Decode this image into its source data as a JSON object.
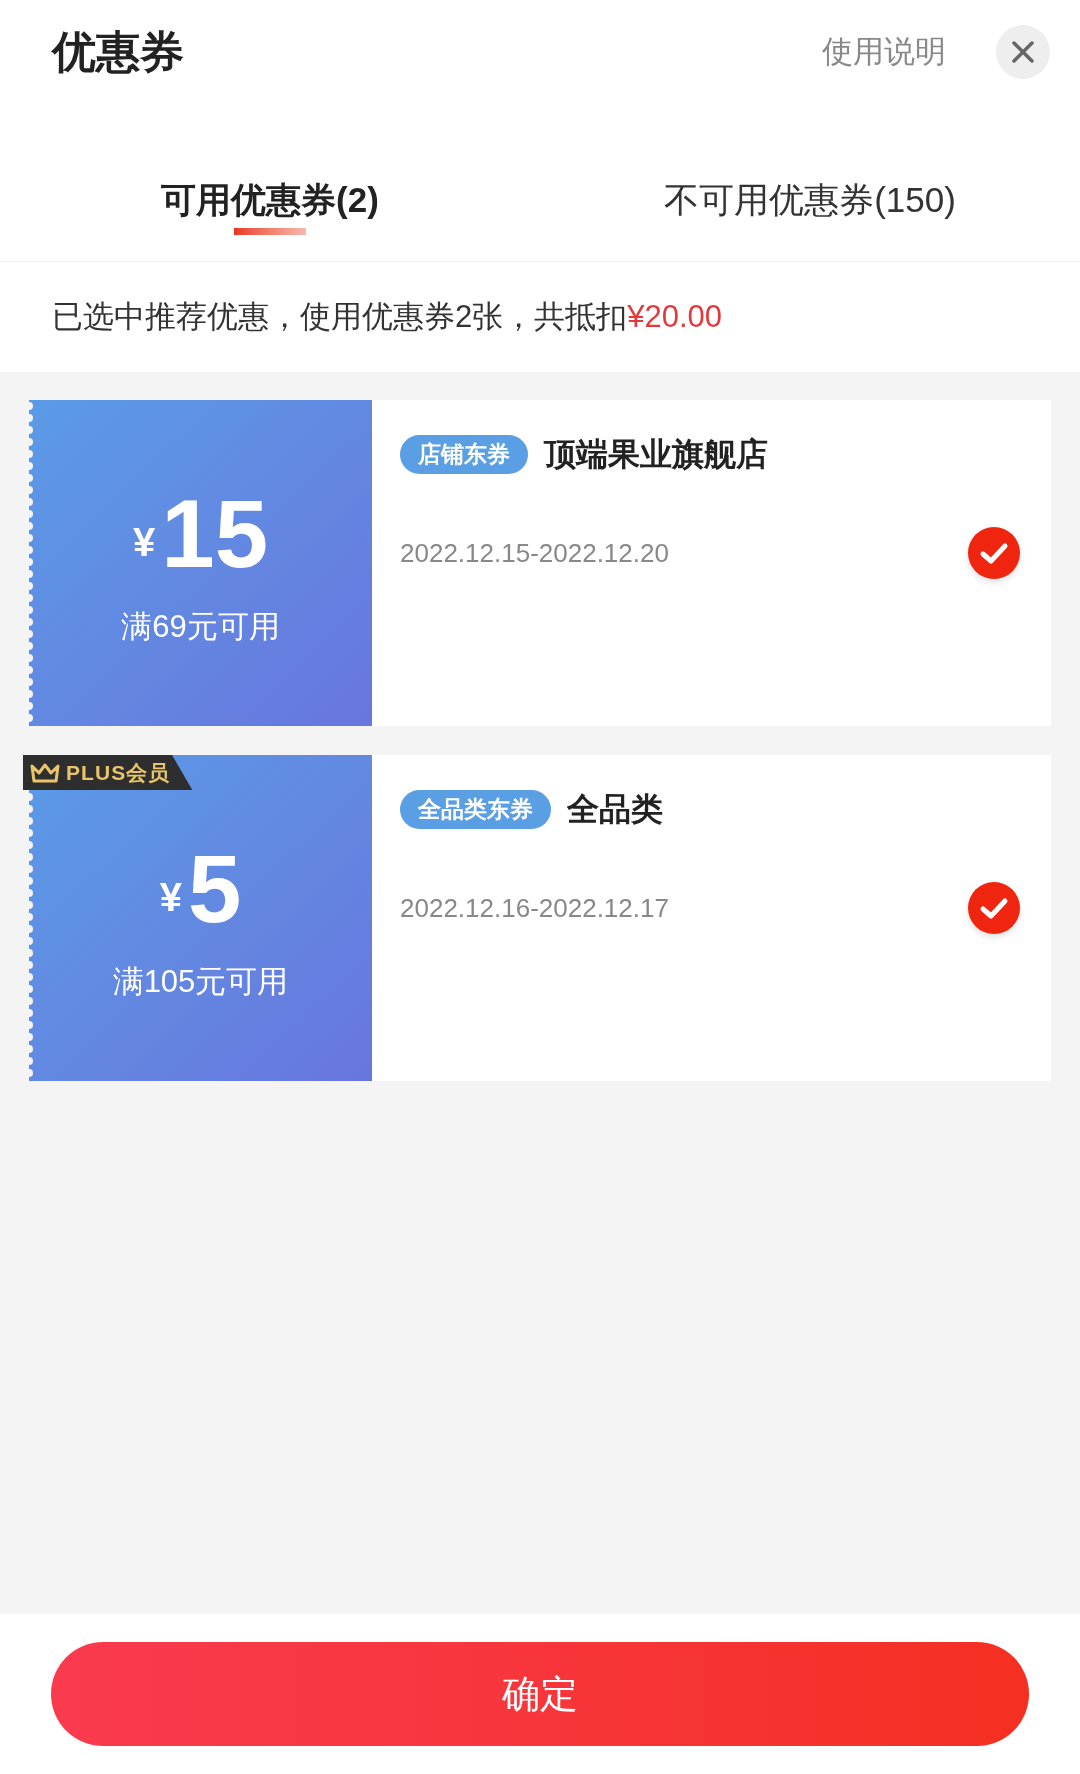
{
  "header": {
    "title": "优惠券",
    "help_link": "使用说明"
  },
  "tabs": [
    {
      "label": "可用优惠券(2)",
      "selected": true
    },
    {
      "label": "不可用优惠券(150)",
      "selected": false
    }
  ],
  "summary": {
    "text": "已选中推荐优惠，使用优惠券2张，共抵扣",
    "amount": "¥20.00"
  },
  "coupons": [
    {
      "currency": "¥",
      "amount": "15",
      "condition": "满69元可用",
      "tag": "店铺东券",
      "name": "顶端果业旗舰店",
      "validity": "2022.12.15-2022.12.20",
      "selected": true
    },
    {
      "badge": "PLUS会员",
      "currency": "¥",
      "amount": "5",
      "condition": "满105元可用",
      "tag": "全品类东券",
      "name": "全品类",
      "validity": "2022.12.16-2022.12.17",
      "selected": true
    }
  ],
  "confirm_button": "确定"
}
